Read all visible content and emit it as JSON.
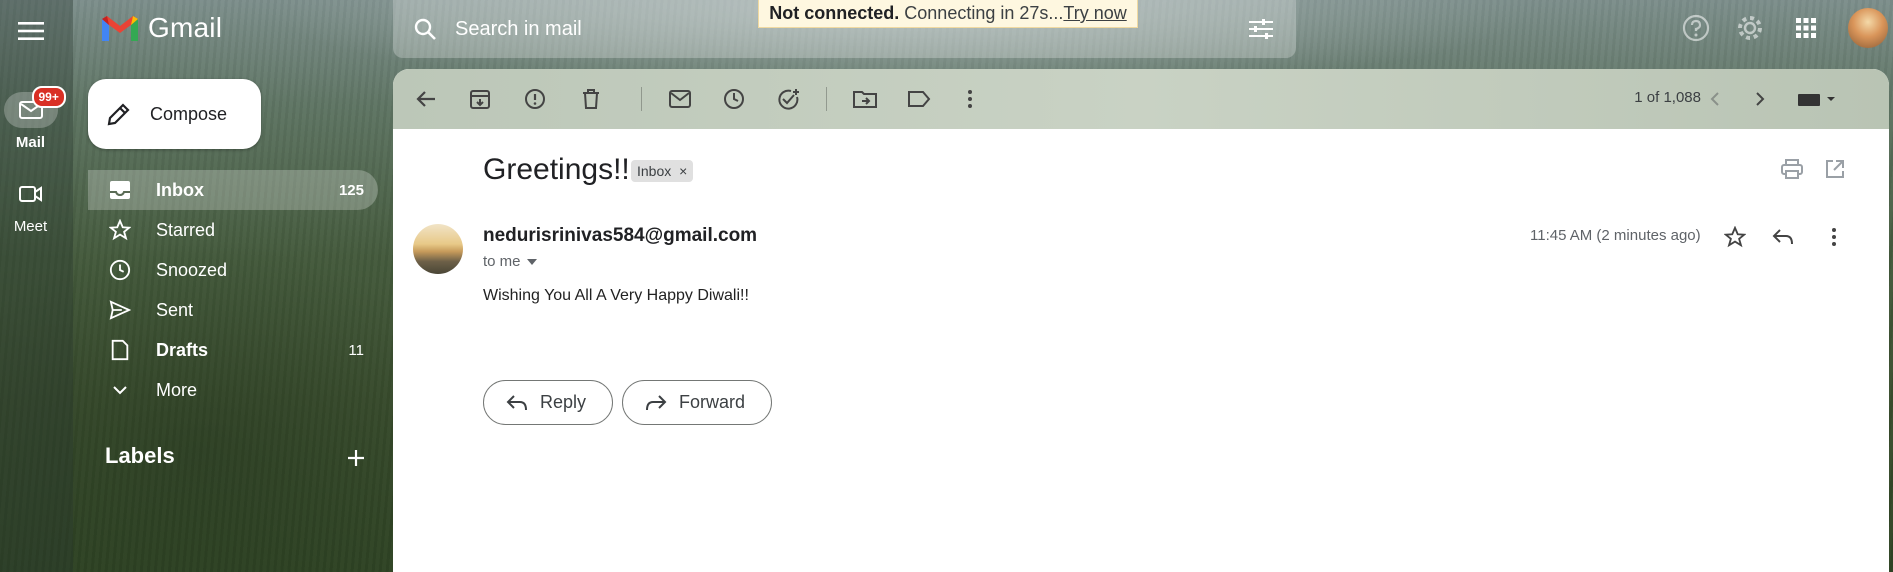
{
  "app": {
    "name": "Gmail"
  },
  "rail": {
    "mail_label": "Mail",
    "mail_badge": "99+",
    "meet_label": "Meet"
  },
  "compose": {
    "label": "Compose"
  },
  "nav": {
    "items": [
      {
        "label": "Inbox",
        "count": "125",
        "icon": "inbox-icon"
      },
      {
        "label": "Starred",
        "count": "",
        "icon": "star-icon"
      },
      {
        "label": "Snoozed",
        "count": "",
        "icon": "clock-icon"
      },
      {
        "label": "Sent",
        "count": "",
        "icon": "send-icon"
      },
      {
        "label": "Drafts",
        "count": "11",
        "icon": "draft-icon"
      },
      {
        "label": "More",
        "count": "",
        "icon": "chevron-down-icon"
      }
    ],
    "labels_heading": "Labels"
  },
  "search": {
    "placeholder": "Search in mail"
  },
  "banner": {
    "bold": "Not connected.",
    "text": "Connecting in 27s...",
    "link": "Try now"
  },
  "toolbar": {
    "pager": "1 of 1,088"
  },
  "email": {
    "subject": "Greetings!!",
    "label_chip": "Inbox",
    "sender": "nedurisrinivas584@gmail.com",
    "recipient": "to me",
    "timestamp": "11:45 AM (2 minutes ago)",
    "body": "Wishing You All A Very Happy Diwali!!"
  },
  "actions": {
    "reply_label": "Reply",
    "forward_label": "Forward"
  },
  "colors": {
    "gmail_red": "#EA4335",
    "badge_red": "#D93025",
    "panel_bg": "#FFFFFF"
  }
}
